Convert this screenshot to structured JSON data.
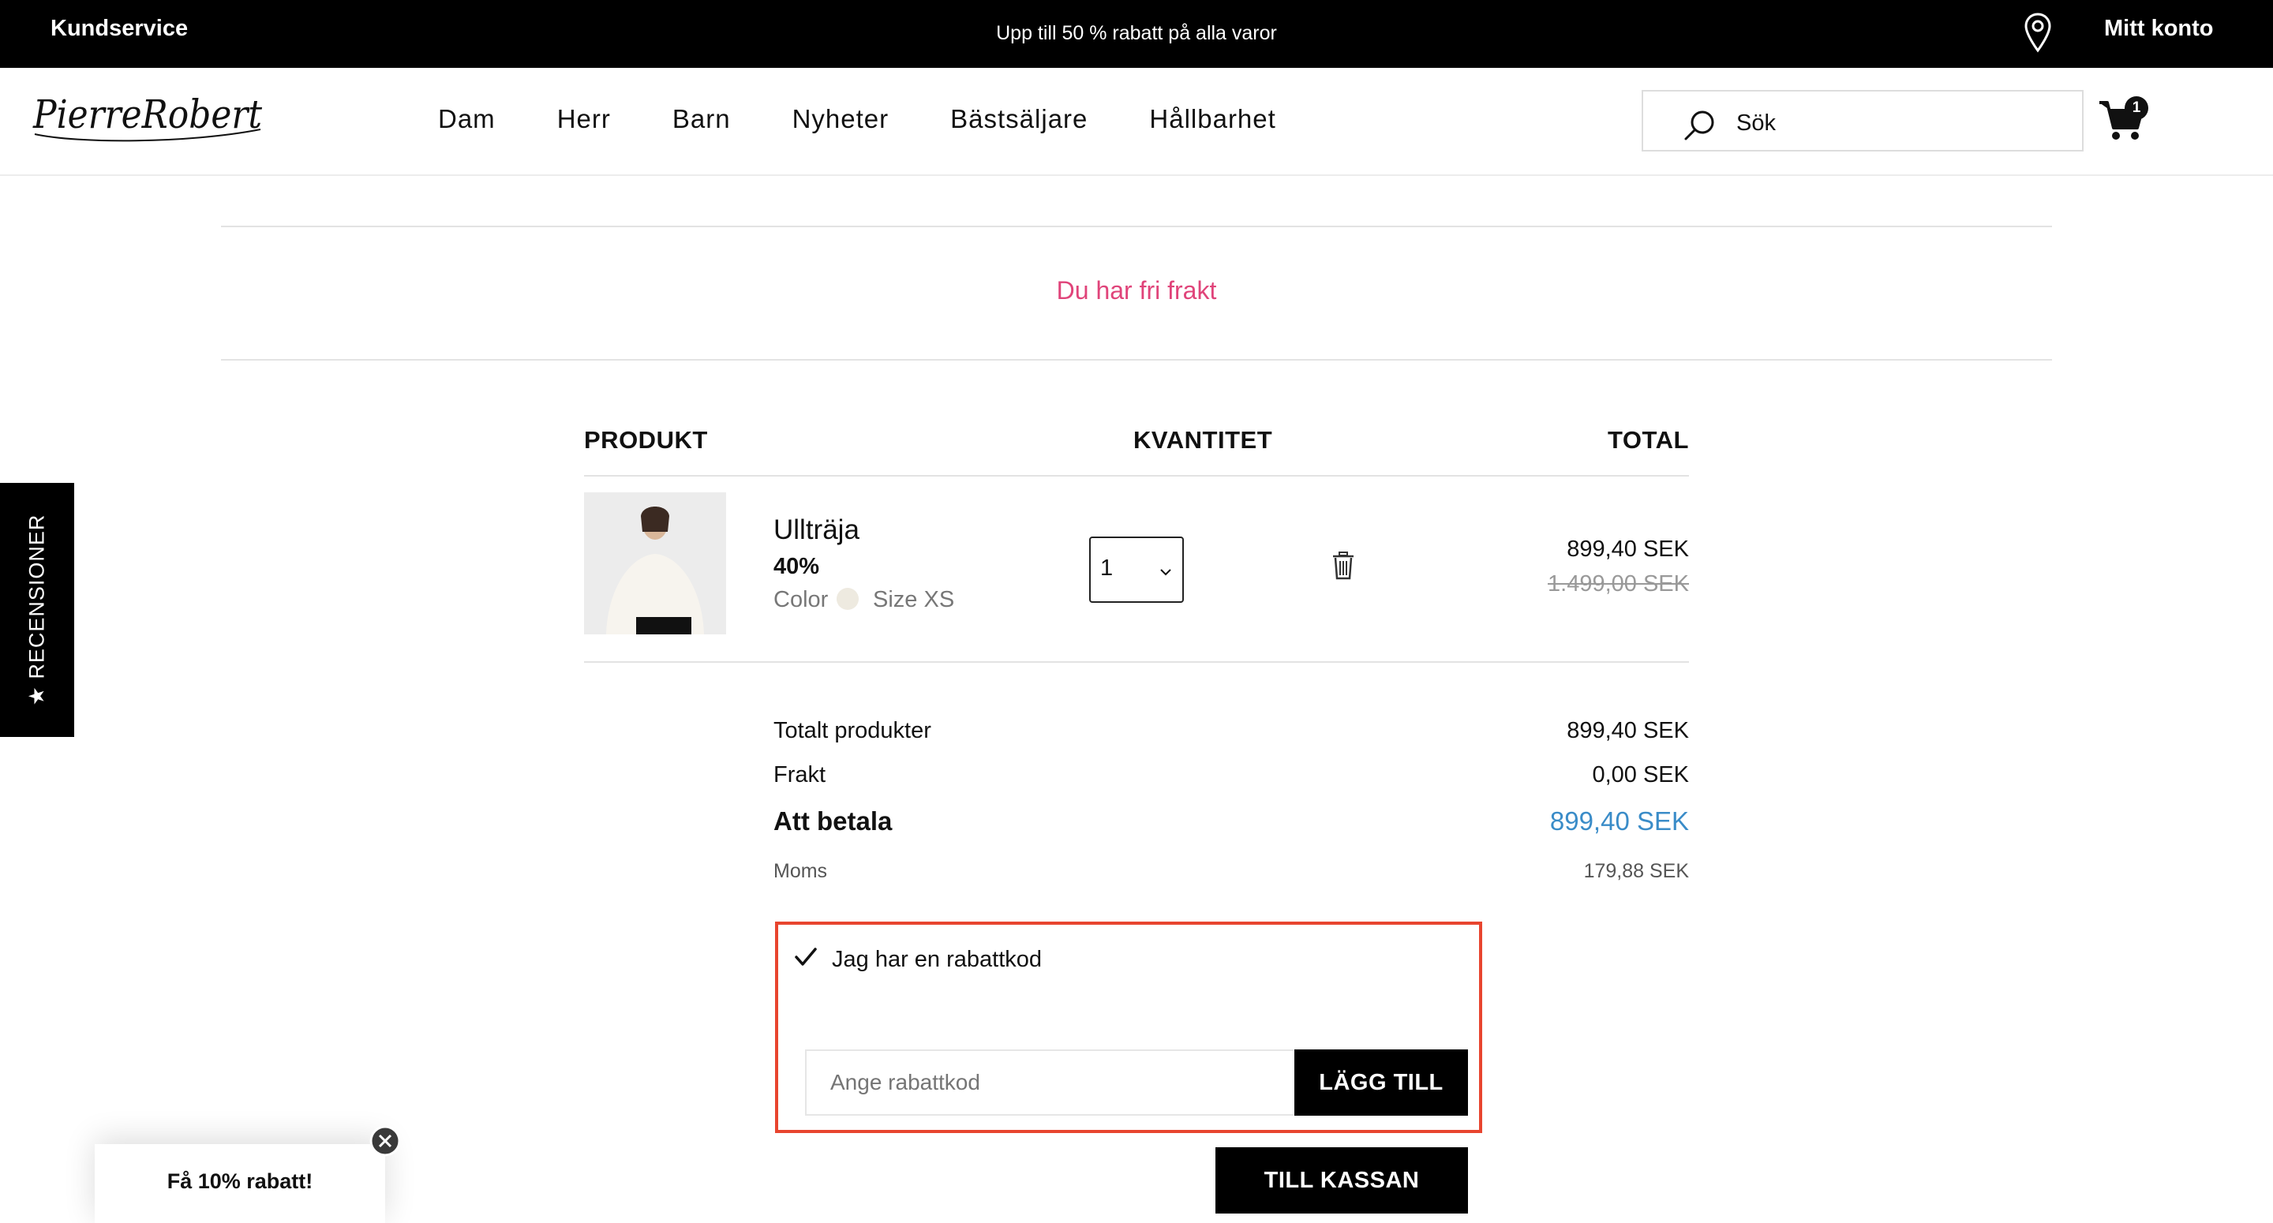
{
  "topbar": {
    "customer_service": "Kundservice",
    "promo": "Upp till 50 % rabatt på alla varor",
    "account": "Mitt konto",
    "location_icon": "map-pin-icon"
  },
  "header": {
    "logo_text": "PierreRobert",
    "nav": [
      "Dam",
      "Herr",
      "Barn",
      "Nyheter",
      "Bästsäljare",
      "Hållbarhet"
    ],
    "search_placeholder": "Sök",
    "search_icon": "search-icon",
    "cart_icon": "cart-icon",
    "cart_count": "1"
  },
  "shipping_notice": "Du har fri frakt",
  "cart": {
    "headers": {
      "product": "PRODUKT",
      "quantity": "KVANTITET",
      "total": "TOTAL"
    },
    "items": [
      {
        "name": "Ullträja",
        "discount": "40%",
        "color_label": "Color",
        "color_swatch": "#eeeae0",
        "size_label": "Size XS",
        "quantity": "1",
        "price": "899,40 SEK",
        "original_price": "1.499,00 SEK"
      }
    ]
  },
  "summary": {
    "products_label": "Totalt produkter",
    "products_value": "899,40 SEK",
    "shipping_label": "Frakt",
    "shipping_value": "0,00 SEK",
    "pay_label": "Att betala",
    "pay_value": "899,40 SEK",
    "vat_label": "Moms",
    "vat_value": "179,88 SEK"
  },
  "discount": {
    "checkbox_label": "Jag har en rabattkod",
    "checked": true,
    "input_placeholder": "Ange rabattkod",
    "add_button": "LÄGG TILL"
  },
  "checkout_button": "TILL KASSAN",
  "reviews_tab": "★ RECENSIONER",
  "promo_popup": "Få 10% rabatt!",
  "colors": {
    "accent_pink": "#e0447a",
    "accent_blue": "#3a8cc8",
    "highlight_border": "#e8452f"
  }
}
